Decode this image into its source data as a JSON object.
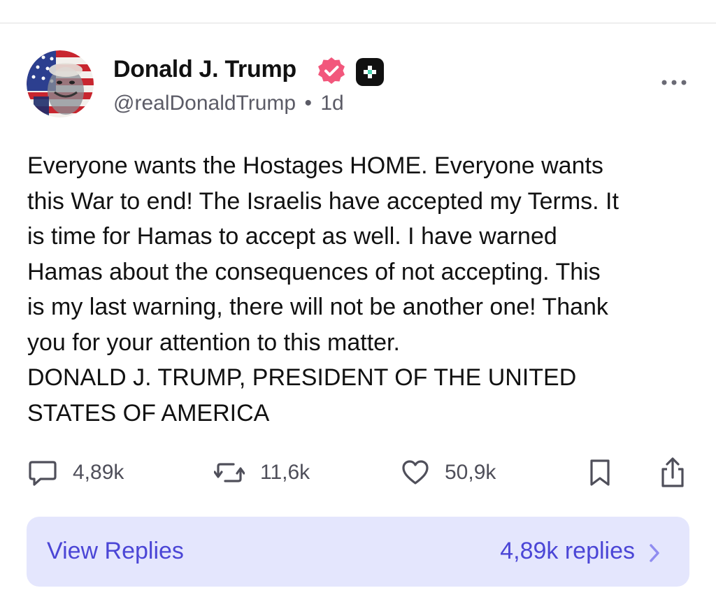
{
  "post": {
    "author_name": "Donald J. Trump",
    "handle": "@realDonaldTrump",
    "separator": "•",
    "time_ago": "1d",
    "body_lines": [
      "Everyone wants the Hostages HOME. Everyone wants",
      "this War to end! The Israelis have accepted my Terms. It",
      "is time for Hamas to accept as well. I have warned",
      "Hamas about the consequences of not accepting. This",
      "is my last warning, there will not be another one! Thank",
      "you for your attention to this matter.",
      "DONALD J. TRUMP, PRESIDENT OF THE UNITED",
      "STATES OF AMERICA"
    ]
  },
  "actions": {
    "replies": {
      "icon": "comment-icon",
      "count": "4,89k"
    },
    "reposts": {
      "icon": "repost-icon",
      "count": "11,6k"
    },
    "likes": {
      "icon": "heart-icon",
      "count": "50,9k"
    },
    "bookmark": {
      "icon": "bookmark-icon"
    },
    "share": {
      "icon": "share-icon"
    }
  },
  "replies_bar": {
    "label": "View Replies",
    "count_label": "4,89k replies"
  },
  "icons": {
    "verified": "verified-badge-icon",
    "plus": "plus-badge-icon",
    "more": "more-icon",
    "chevron": "chevron-right-icon"
  },
  "colors": {
    "verified_badge": "#f2577c",
    "replies_bar_bg": "#e4e6fd",
    "replies_text": "#4b46d6",
    "secondary_text": "#5b5b66"
  }
}
